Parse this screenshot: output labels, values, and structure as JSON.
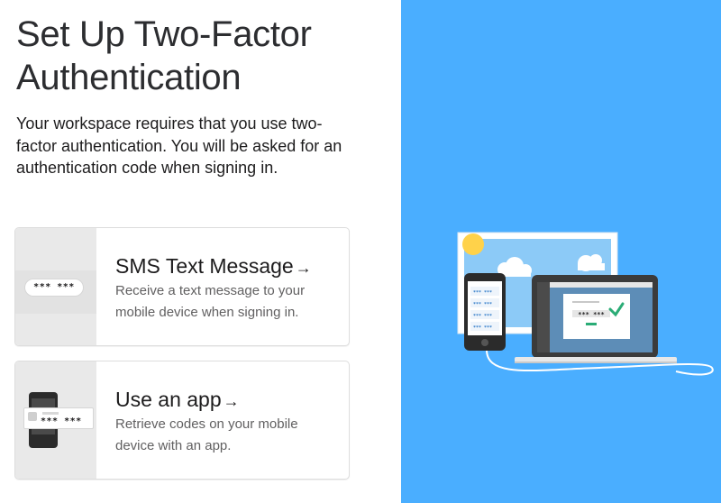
{
  "page": {
    "title": "Set Up Two-Factor Authentication",
    "description": "Your workspace requires that you use two-factor authentication. You will be asked for an authentication code when signing in."
  },
  "options": [
    {
      "id": "sms",
      "title": "SMS Text Message",
      "arrow": "→",
      "description": "Receive a text message to your mobile device when signing in.",
      "illustration_code": "*** ***",
      "icon": "sms-bubble-icon"
    },
    {
      "id": "app",
      "title": "Use an app",
      "arrow": "→",
      "description": "Retrieve codes on your mobile device with an app.",
      "illustration_code": "*** ***",
      "icon": "phone-app-icon"
    }
  ],
  "illustration": {
    "background_color": "#4aaeff",
    "phone_codes": [
      "*** ***",
      "*** ***",
      "*** ***",
      "*** ***"
    ],
    "laptop_code": "*** ***",
    "icon": "devices-illustration"
  },
  "colors": {
    "accent_blue": "#4aaeff",
    "check_green": "#2bac76",
    "text_dark": "#1d1c1d",
    "text_muted": "#616061"
  }
}
